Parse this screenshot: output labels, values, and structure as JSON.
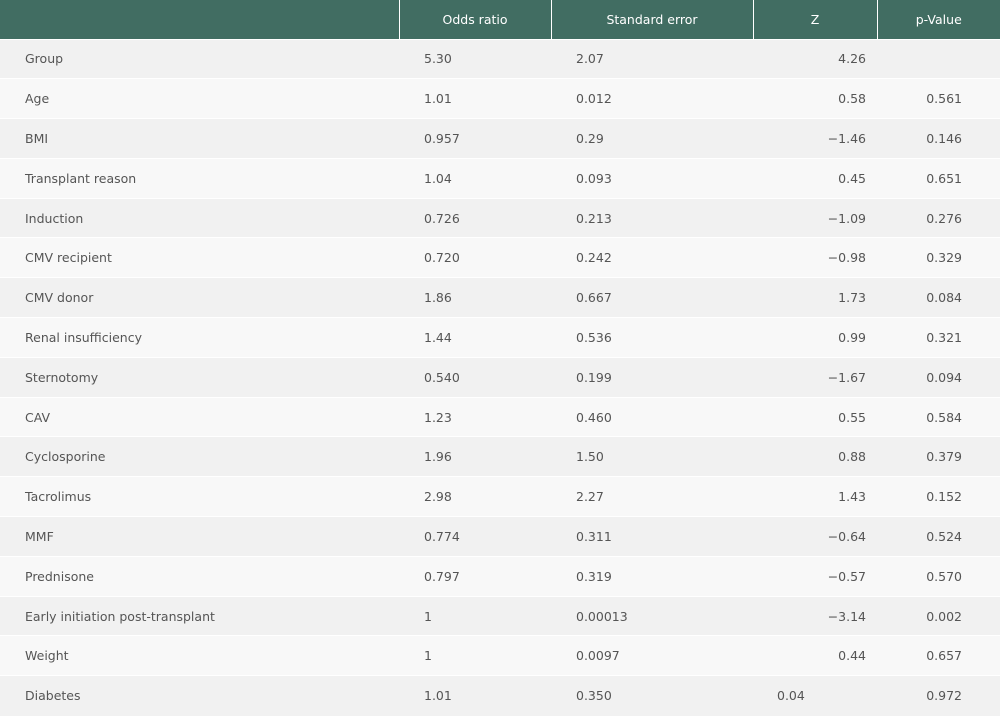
{
  "table": {
    "headers": {
      "variable": "",
      "odds_ratio": "Odds ratio",
      "standard_error": "Standard error",
      "z": "Z",
      "p_value": "p-Value"
    },
    "rows": [
      {
        "variable": "Group",
        "odds_ratio": "5.30",
        "standard_error": "2.07",
        "z": "4.26",
        "p_value": ""
      },
      {
        "variable": "Age",
        "odds_ratio": "1.01",
        "standard_error": "0.012",
        "z": "0.58",
        "p_value": "0.561"
      },
      {
        "variable": "BMI",
        "odds_ratio": "0.957",
        "standard_error": "0.29",
        "z": "−1.46",
        "p_value": "0.146"
      },
      {
        "variable": "Transplant reason",
        "odds_ratio": "1.04",
        "standard_error": "0.093",
        "z": "0.45",
        "p_value": "0.651"
      },
      {
        "variable": "Induction",
        "odds_ratio": "0.726",
        "standard_error": "0.213",
        "z": "−1.09",
        "p_value": "0.276"
      },
      {
        "variable": "CMV recipient",
        "odds_ratio": "0.720",
        "standard_error": "0.242",
        "z": "−0.98",
        "p_value": "0.329"
      },
      {
        "variable": "CMV donor",
        "odds_ratio": "1.86",
        "standard_error": "0.667",
        "z": "1.73",
        "p_value": "0.084"
      },
      {
        "variable": "Renal insufficiency",
        "odds_ratio": "1.44",
        "standard_error": "0.536",
        "z": "0.99",
        "p_value": "0.321"
      },
      {
        "variable": "Sternotomy",
        "odds_ratio": "0.540",
        "standard_error": "0.199",
        "z": "−1.67",
        "p_value": "0.094"
      },
      {
        "variable": "CAV",
        "odds_ratio": "1.23",
        "standard_error": "0.460",
        "z": "0.55",
        "p_value": "0.584"
      },
      {
        "variable": "Cyclosporine",
        "odds_ratio": "1.96",
        "standard_error": "1.50",
        "z": "0.88",
        "p_value": "0.379"
      },
      {
        "variable": "Tacrolimus",
        "odds_ratio": "2.98",
        "standard_error": "2.27",
        "z": "1.43",
        "p_value": "0.152"
      },
      {
        "variable": "MMF",
        "odds_ratio": "0.774",
        "standard_error": "0.311",
        "z": "−0.64",
        "p_value": "0.524"
      },
      {
        "variable": "Prednisone",
        "odds_ratio": "0.797",
        "standard_error": "0.319",
        "z": "−0.57",
        "p_value": "0.570"
      },
      {
        "variable": "Early initiation post-transplant",
        "odds_ratio": "1",
        "standard_error": "0.00013",
        "z": "−3.14",
        "p_value": "0.002"
      },
      {
        "variable": "Weight",
        "odds_ratio": "1",
        "standard_error": "0.0097",
        "z": "0.44",
        "p_value": "0.657"
      },
      {
        "variable": "Diabetes",
        "odds_ratio": "1.01",
        "standard_error": "0.350",
        "z": "0.04",
        "p_value": "0.972",
        "z_left_aligned": true
      }
    ]
  },
  "colors": {
    "header_bg": "#416d62",
    "header_text": "#ffffff",
    "row_odd": "#f1f1f1",
    "row_even": "#f8f8f8",
    "cell_text": "#555555"
  }
}
